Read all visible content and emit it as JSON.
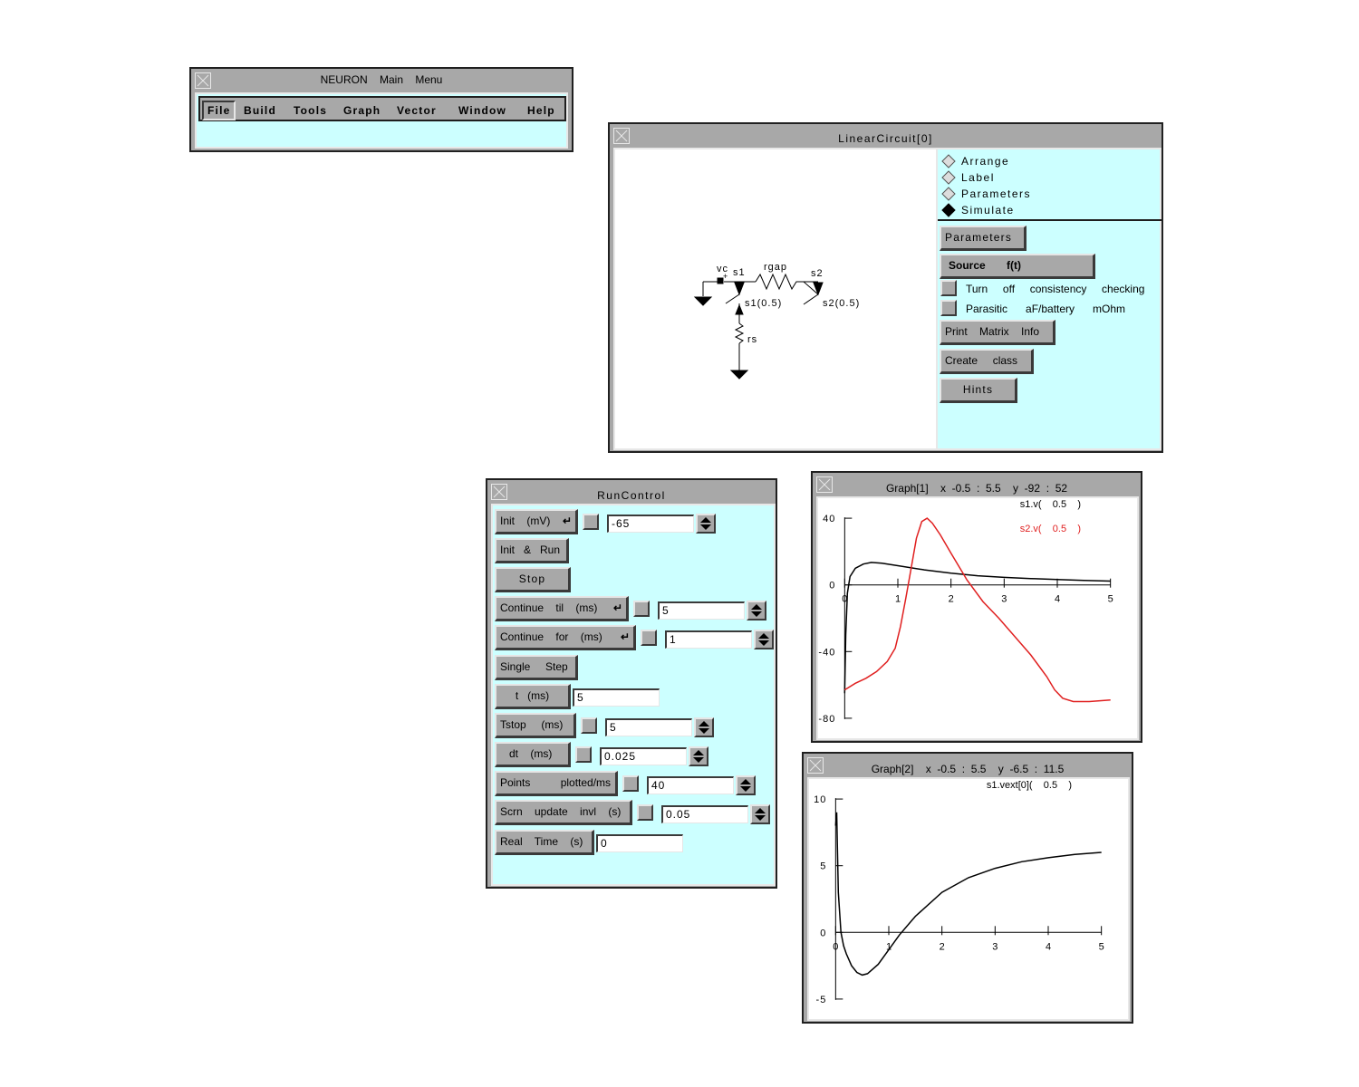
{
  "main_menu": {
    "title": "NEURON    Main    Menu",
    "items": [
      "File",
      "Build",
      "Tools",
      "Graph",
      "Vector",
      "Window",
      "Help"
    ]
  },
  "linear_circuit": {
    "title": "LinearCircuit[0]",
    "modes": [
      {
        "label": "Arrange",
        "selected": false
      },
      {
        "label": "Label",
        "selected": false
      },
      {
        "label": "Parameters",
        "selected": false
      },
      {
        "label": "Simulate",
        "selected": true
      }
    ],
    "parameters_button": "Parameters",
    "source_button": "Source       f(t)",
    "consistency_label": "Turn     off     consistency     checking",
    "parasitic_label": "Parasitic      aF/battery      mOhm",
    "print_matrix_button": "Print    Matrix    Info",
    "create_class_button": "Create     class",
    "hints_button": "Hints",
    "circuit_labels": {
      "vc": "vc",
      "plus": "+",
      "s1": "s1",
      "rgap": "rgap",
      "s2": "s2",
      "s1_loc": "s1(0.5)",
      "s2_loc": "s2(0.5)",
      "rs": "rs"
    }
  },
  "run_control": {
    "title": "RunControl",
    "rows": [
      {
        "label": "Init    (mV)",
        "value": "-65"
      },
      {
        "label": "Init   &   Run"
      },
      {
        "label": "Stop"
      },
      {
        "label": "Continue    til    (ms)",
        "value": "5"
      },
      {
        "label": "Continue    for    (ms)",
        "value": "1"
      },
      {
        "label": "Single     Step"
      },
      {
        "label": "t   (ms)",
        "value": "5"
      },
      {
        "label": "Tstop     (ms)",
        "value": "5"
      },
      {
        "label": "dt    (ms)",
        "value": "0.025"
      },
      {
        "label": "Points          plotted/ms",
        "value": "40"
      },
      {
        "label": "Scrn    update    invl    (s)",
        "value": "0.05"
      },
      {
        "label": "Real    Time    (s)",
        "value": "0"
      }
    ]
  },
  "graph1": {
    "title": "Graph[1]    x  -0.5  :  5.5    y  -92  :  52",
    "legend": [
      {
        "text": "s1.v(    0.5    )",
        "color": "#000000"
      },
      {
        "text": "s2.v(    0.5    )",
        "color": "#e02020"
      }
    ]
  },
  "graph2": {
    "title": "Graph[2]    x  -0.5  :  5.5    y  -6.5  :  11.5",
    "legend": [
      {
        "text": "s1.vext[0](    0.5    )",
        "color": "#000000"
      }
    ]
  },
  "chart_data": [
    {
      "type": "line",
      "xlim": [
        -0.5,
        5.5
      ],
      "ylim": [
        -92,
        52
      ],
      "x_ticks": [
        0,
        1,
        2,
        3,
        4,
        5
      ],
      "y_ticks": [
        40,
        0,
        -40,
        -80
      ],
      "legend_position": "top-right",
      "grid": false,
      "series": [
        {
          "name": "s1.v(    0.5    )",
          "color": "#000000",
          "x": [
            0,
            0.02,
            0.05,
            0.1,
            0.2,
            0.35,
            0.5,
            0.7,
            1.0,
            1.5,
            2.0,
            2.5,
            3.0,
            3.5,
            4.0,
            4.5,
            5.0
          ],
          "y": [
            -65,
            -30,
            -5,
            5,
            10,
            12.5,
            13.5,
            13,
            11.5,
            9,
            7,
            5.5,
            4.5,
            3.8,
            3.2,
            2.7,
            2.3
          ]
        },
        {
          "name": "s2.v(    0.5    )",
          "color": "#e02020",
          "x": [
            0,
            0.2,
            0.4,
            0.6,
            0.8,
            0.95,
            1.05,
            1.15,
            1.25,
            1.35,
            1.45,
            1.55,
            1.65,
            1.8,
            2.0,
            2.3,
            2.6,
            2.9,
            3.2,
            3.5,
            3.8,
            3.95,
            4.1,
            4.3,
            4.6,
            5.0
          ],
          "y": [
            -63,
            -59,
            -56,
            -52,
            -46,
            -38,
            -25,
            -8,
            10,
            28,
            38,
            40,
            37,
            30,
            19,
            3,
            -10,
            -20,
            -31,
            -42,
            -55,
            -63,
            -68,
            -70,
            -70,
            -69
          ]
        }
      ]
    },
    {
      "type": "line",
      "xlim": [
        -0.5,
        5.5
      ],
      "ylim": [
        -6.5,
        11.5
      ],
      "x_ticks": [
        0,
        1,
        2,
        3,
        4,
        5
      ],
      "y_ticks": [
        10,
        5,
        0,
        -5
      ],
      "legend_position": "top-right",
      "grid": false,
      "series": [
        {
          "name": "s1.vext[0](    0.5    )",
          "color": "#000000",
          "x": [
            0,
            0.02,
            0.05,
            0.1,
            0.15,
            0.2,
            0.3,
            0.4,
            0.5,
            0.6,
            0.8,
            1.0,
            1.2,
            1.5,
            2.0,
            2.5,
            3.0,
            3.5,
            4.0,
            4.5,
            5.0
          ],
          "y": [
            8,
            9,
            3,
            0,
            -1,
            -1.6,
            -2.5,
            -3,
            -3.2,
            -3.1,
            -2.4,
            -1.3,
            -0.2,
            1.2,
            3.0,
            4.1,
            4.8,
            5.3,
            5.6,
            5.85,
            6.0
          ]
        }
      ]
    }
  ]
}
